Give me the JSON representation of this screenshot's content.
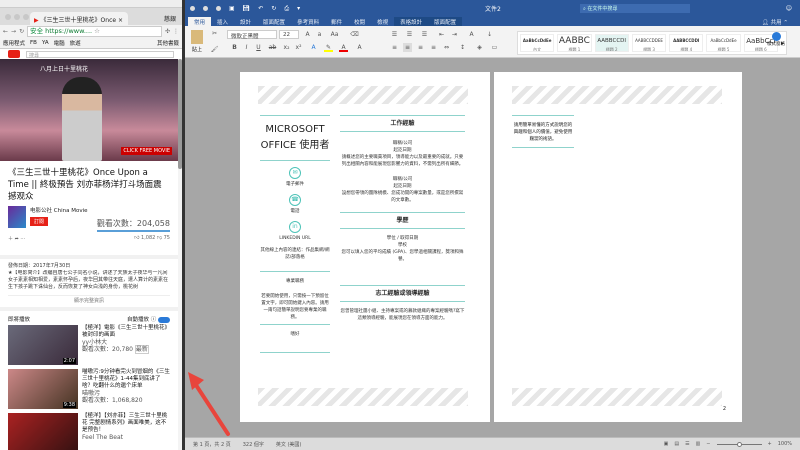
{
  "chrome": {
    "tab_title": "《三生三世十里桃花》Once",
    "profile": "慈銀",
    "secure_label": "安全",
    "url": "https://www....",
    "bookmarks": [
      "應用程式",
      "FB",
      "YA",
      "電腦",
      "旅遊"
    ],
    "other_bookmarks": "其他書籤",
    "search_placeholder": "搜尋"
  },
  "youtube": {
    "video_overlay_title": "八月上日十里桃花",
    "click_badge": "CLICK FREE MOVIE",
    "title": "《三生三世十里桃花》Once Upon a Time || 終极預告 刘亦菲杨洋打斗场面震撼观众",
    "channel": "电影公社 China Movie",
    "subscribe": "訂閱",
    "views": "觀看次數：204,058",
    "likes": "1,082",
    "dislikes": "75",
    "publish_date": "發佈日期：2017年7月30日",
    "description": "★【电影简介】改编自唐七公子同名小说，讲述了天族太子夜华与一凡间女子素素相知相爱，素素怀孕后，夜华回其带往天庭，遭人算计的素素在生下孩子跳下诛仙台，反而恢复了神女白浅的身份，桃花树",
    "show_more": "顯示完整資訊",
    "up_next": "即將播放",
    "autoplay": "自動播放",
    "list": [
      {
        "title": "【極洋】電影《三生三世十里桃花》被封印的画面",
        "channel": "yy小林大",
        "views": "觀看次數：20,780",
        "badge": "最新",
        "duration": "2:07"
      },
      {
        "title": "喵嗷污:9分钟看完火到冒烟的《三生三世十里桃花》1-44集到底讲了啥？吃翻什么的邋个床单",
        "channel": "喵嗷污",
        "views": "觀看次數：1,068,820",
        "duration": "9:38"
      },
      {
        "title": "【極洋】【刘亦菲】三生三世十里桃花 完整剧情系列》画面唯美，这不是预告！",
        "channel": "Feel The Beat"
      }
    ]
  },
  "word": {
    "doc_title": "文件2",
    "search_placeholder": "在文件中搜尋",
    "share": "共用",
    "tabs": [
      "常用",
      "插入",
      "設計",
      "版面配置",
      "參考資料",
      "郵件",
      "校閱",
      "檢視",
      "表格設計",
      "版面配置"
    ],
    "paste": "貼上",
    "font": "微軟正黑體",
    "size": "22",
    "styles": [
      {
        "preview": "AaBbCcDdEe",
        "name": "內文"
      },
      {
        "preview": "AABBC",
        "name": "標題 1"
      },
      {
        "preview": "AABBCCDI",
        "name": "標題 2"
      },
      {
        "preview": "AABBCCDDEE",
        "name": "標題 3"
      },
      {
        "preview": "AABBCCDDI",
        "name": "標題 4"
      },
      {
        "preview": "AaBbCcDdEe",
        "name": "標題 5"
      },
      {
        "preview": "AaBbCcI",
        "name": "標題 6"
      }
    ],
    "styles_pane": "樣式窗格",
    "page1": {
      "name": "MICROSOFT OFFICE 使用者",
      "email": "電子郵件",
      "phone": "電話",
      "linkedin": "LINKEDIN URL",
      "link_hint": "其他線上內容的連結：作品集網/網誌/部落格",
      "skills": "專業職務",
      "skills_text": "若要開始使用，只需按一下預留位置文字，即可開始鍵入內容。請用一兩句話簡單說明您要專業的職務。",
      "hobbies": "嗜好",
      "work_heading": "工作經驗",
      "job": "職稱/公司",
      "dates": "起訖日期",
      "job1_text": "請概述您的主要職責項目，領導能力以及最重要的成就。只要列出相關內容和能展現您影響力的資料，不需列出所有細節。",
      "job2_text": "設想您帶領的團隊規模、您成功開的專案數量，或是您所撰寫的文章數。",
      "edu_heading": "學歷",
      "degree": "學位 / 取得日期",
      "school": "學校",
      "edu_text": "您可以填入您的平均成績 (GPA)、您學過相關課程，獎項和殊譽。",
      "vol_heading": "志工經驗或領導經驗",
      "vol_text": "您曾管理社團小組、主持專案或的募款組織的專案經驗嗎?寫下這類領導經驗，能展現您在領導方面的能力。"
    },
    "page2": {
      "text": "請用簡單易懂的方式說明您的興趣和個人的價值，避免使用艱澀的術語。",
      "page_number": "2"
    },
    "status": {
      "page": "第 1 頁，共 2 頁",
      "words": "322 個字",
      "lang": "英文 (美國)",
      "zoom": "100%"
    }
  },
  "colors": {
    "word_blue": "#2b579a",
    "teal": "#8fd3cc",
    "youtube_red": "#e62117",
    "arrow": "#e8453c"
  }
}
